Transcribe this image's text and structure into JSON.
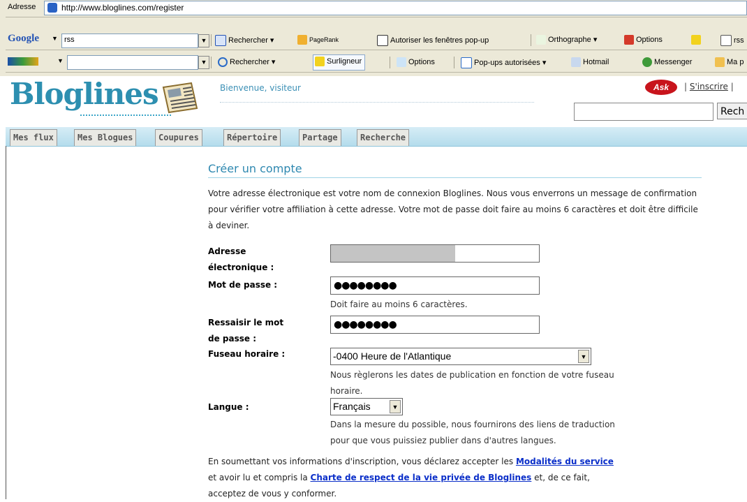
{
  "browser": {
    "address_label": "Adresse",
    "url": "http://www.bloglines.com/register",
    "google_toolbar": {
      "brand": "Google",
      "query": "rss",
      "search_button": "Rechercher",
      "pagerank": "PageRank",
      "popups": "Autoriser les fenêtres pop-up",
      "spelling": "Orthographe",
      "options": "Options",
      "rss": "rss"
    },
    "msn_toolbar": {
      "search_button": "Rechercher",
      "highlighter": "Surligneur",
      "options": "Options",
      "popups_allowed": "Pop-ups autorisées",
      "hotmail": "Hotmail",
      "messenger": "Messenger",
      "my_page": "Ma p"
    }
  },
  "site": {
    "logo": "Bloglines",
    "welcome": "Bienvenue, visiteur",
    "ask": "Ask",
    "register_link": "S'inscrire",
    "search_button": "Rech"
  },
  "tabs": [
    "Mes flux",
    "Mes Blogues",
    "Coupures",
    "Répertoire",
    "Partage",
    "Recherche"
  ],
  "form": {
    "title": "Créer un compte",
    "intro": "Votre adresse électronique est votre nom de connexion Bloglines. Nous vous enverrons un message de confirmation pour vérifier votre affiliation à cette adresse. Votre mot de passe doit faire au moins 6 caractères et doit être difficile à deviner.",
    "email_label_line1": "Adresse",
    "email_label_line2": "électronique :",
    "password_label": "Mot de passe :",
    "password_value": "●●●●●●●●",
    "password_hint": "Doit faire au moins 6 caractères.",
    "confirm_label_line1": "Ressaisir le mot",
    "confirm_label_line2": "de passe :",
    "confirm_value": "●●●●●●●●",
    "timezone_label": "Fuseau horaire :",
    "timezone_value": "-0400 Heure de l'Atlantique",
    "timezone_hint_line1": "Nous règlerons les dates de publication en fonction de votre fuseau",
    "timezone_hint_line2": "horaire.",
    "language_label": "Langue :",
    "language_value": "Français",
    "language_hint_line1": "Dans la mesure du possible, nous fournirons des liens de traduction",
    "language_hint_line2": "pour que vous puissiez publier dans d'autres langues.",
    "footer_part1": "En soumettant vos informations d'inscription, vous déclarez accepter les ",
    "terms_link": "Modalités du service",
    "footer_part2": "et avoir lu et compris la ",
    "privacy_link": "Charte de respect de la vie privée de Bloglines",
    "footer_part3": " et, de ce fait,",
    "footer_part4": "acceptez de vous y conformer."
  },
  "colors": {
    "accent": "#2e88b0",
    "link": "#0b2fc9",
    "tabbar": "#b4dcec"
  }
}
